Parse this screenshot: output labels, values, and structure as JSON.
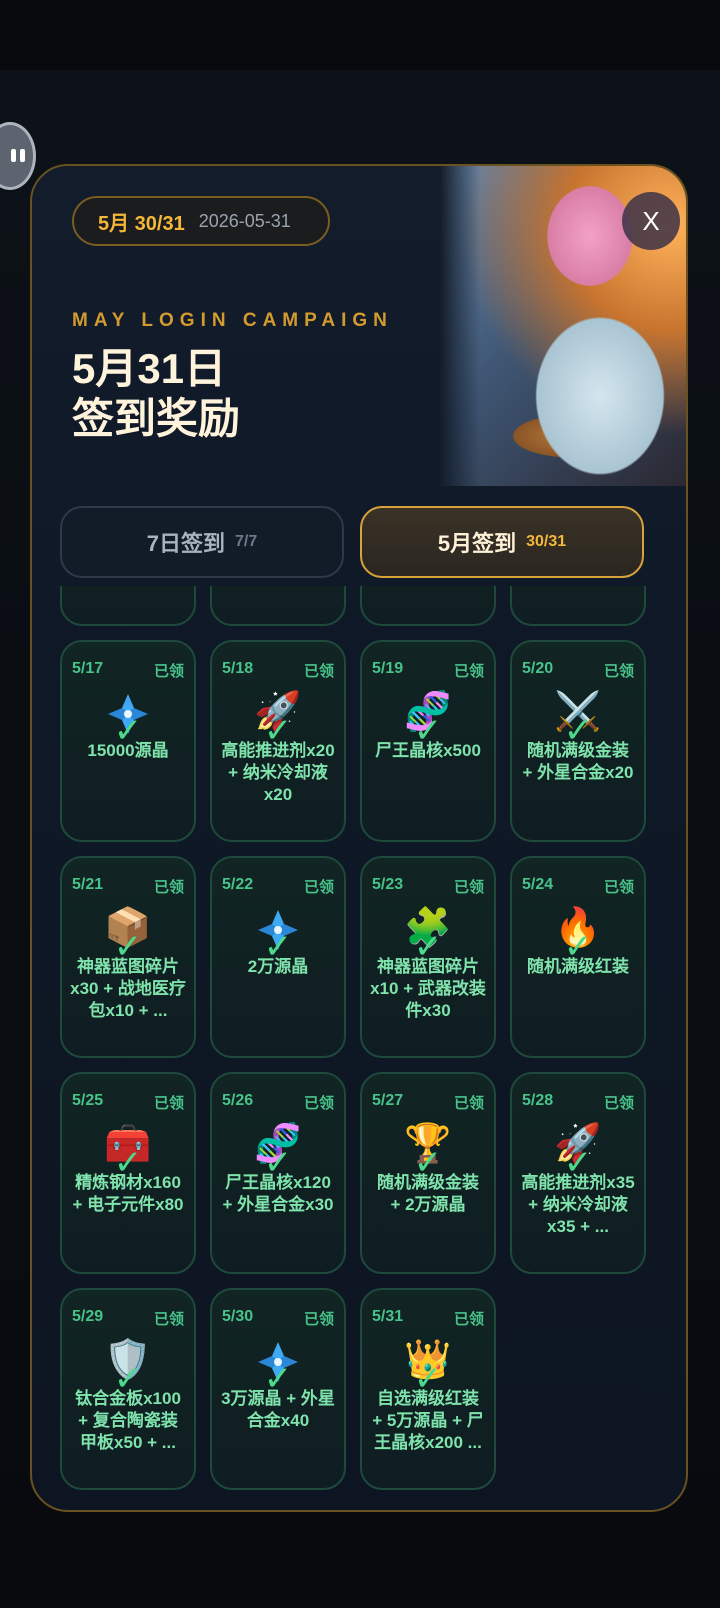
{
  "header": {
    "month_progress": "5月 30/31",
    "date": "2026-05-31",
    "eyebrow": "MAY LOGIN CAMPAIGN",
    "title_line1": "5月31日",
    "title_line2": "签到奖励",
    "close_label": "X"
  },
  "tabs": [
    {
      "label": "7日签到",
      "count": "7/7",
      "active": false
    },
    {
      "label": "5月签到",
      "count": "30/31",
      "active": true
    }
  ],
  "days": [
    {
      "date": "",
      "status": "",
      "reward": "",
      "icon": "partial"
    },
    {
      "date": "",
      "status": "",
      "reward": "",
      "icon": "partial"
    },
    {
      "date": "",
      "status": "",
      "reward": "",
      "icon": "partial"
    },
    {
      "date": "",
      "status": "",
      "reward": "",
      "icon": "partial"
    },
    {
      "date": "5/17",
      "status": "已领",
      "reward": "15000源晶",
      "icon": "crystal-icon"
    },
    {
      "date": "5/18",
      "status": "已领",
      "reward": "高能推进剂x20 + 纳米冷却液x20",
      "icon": "rocket-icon"
    },
    {
      "date": "5/19",
      "status": "已领",
      "reward": "尸王晶核x500",
      "icon": "dna-icon"
    },
    {
      "date": "5/20",
      "status": "已领",
      "reward": "随机满级金装 + 外星合金x20",
      "icon": "crossed-swords-icon"
    },
    {
      "date": "5/21",
      "status": "已领",
      "reward": "神器蓝图碎片x30 + 战地医疗包x10 + ...",
      "icon": "package-icon"
    },
    {
      "date": "5/22",
      "status": "已领",
      "reward": "2万源晶",
      "icon": "crystal-icon"
    },
    {
      "date": "5/23",
      "status": "已领",
      "reward": "神器蓝图碎片x10 + 武器改装件x30",
      "icon": "puzzle-icon"
    },
    {
      "date": "5/24",
      "status": "已领",
      "reward": "随机满级红装",
      "icon": "fire-icon"
    },
    {
      "date": "5/25",
      "status": "已领",
      "reward": "精炼钢材x160 + 电子元件x80",
      "icon": "toolbox-icon"
    },
    {
      "date": "5/26",
      "status": "已领",
      "reward": "尸王晶核x120 + 外星合金x30",
      "icon": "dna-icon"
    },
    {
      "date": "5/27",
      "status": "已领",
      "reward": "随机满级金装 + 2万源晶",
      "icon": "trophy-icon"
    },
    {
      "date": "5/28",
      "status": "已领",
      "reward": "高能推进剂x35 + 纳米冷却液x35 + ...",
      "icon": "rocket-icon"
    },
    {
      "date": "5/29",
      "status": "已领",
      "reward": "钛合金板x100 + 复合陶瓷装甲板x50 + ...",
      "icon": "shield-icon"
    },
    {
      "date": "5/30",
      "status": "已领",
      "reward": "3万源晶 + 外星合金x40",
      "icon": "crystal-icon"
    },
    {
      "date": "5/31",
      "status": "已领",
      "reward": "自选满级红装 + 5万源晶 + 尸王晶核x200 ...",
      "icon": "crown-icon"
    }
  ]
}
